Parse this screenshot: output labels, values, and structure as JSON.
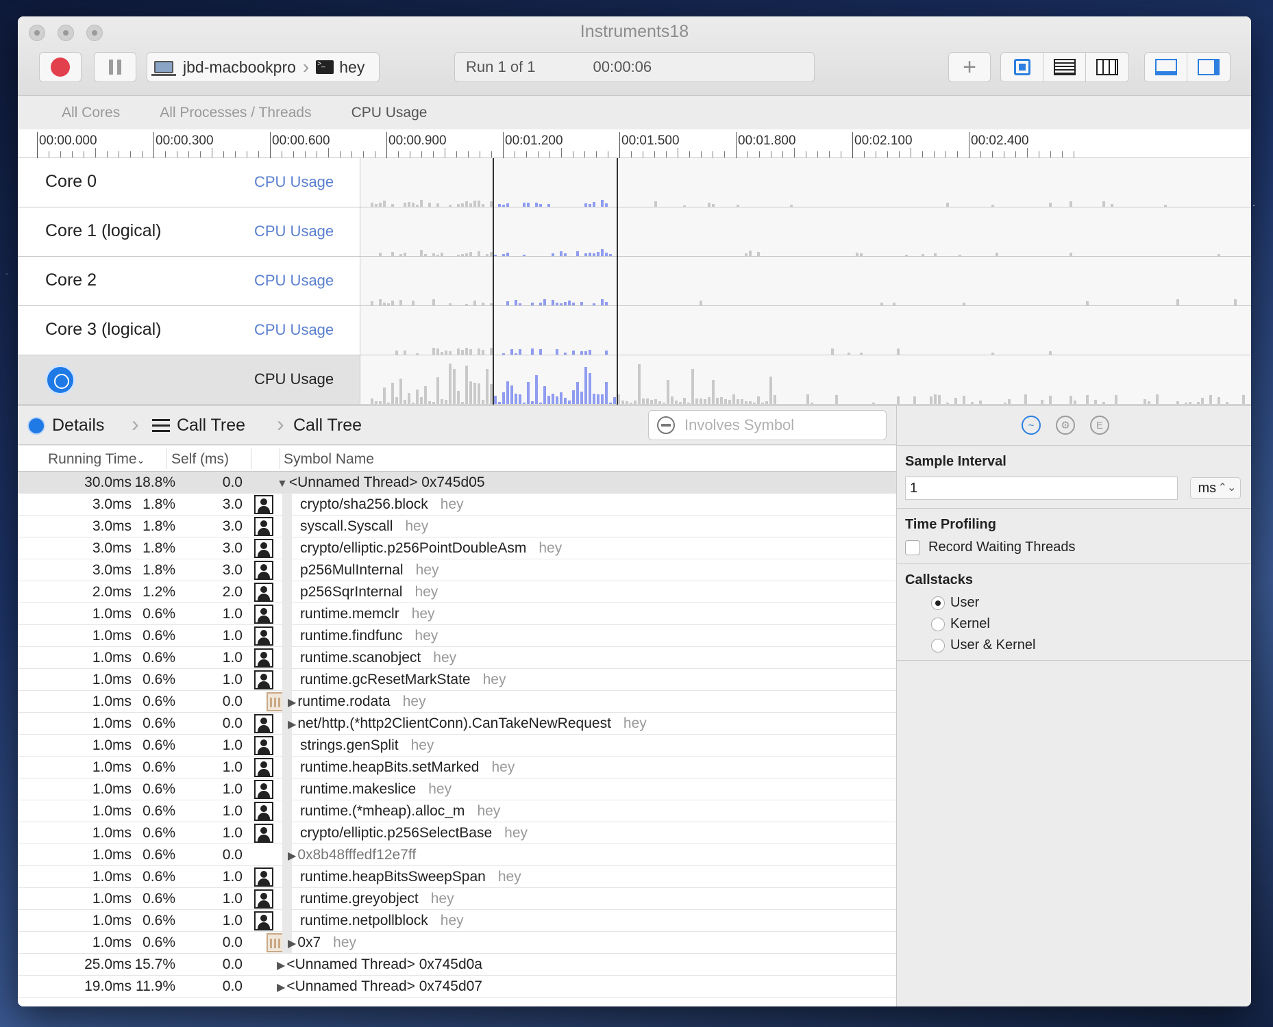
{
  "window": {
    "title": "Instruments18"
  },
  "toolbar": {
    "device": "jbd-macbookpro",
    "process": "hey",
    "run_label": "Run 1 of 1",
    "run_time": "00:00:06"
  },
  "scope": {
    "tabs": [
      "All Cores",
      "All Processes / Threads",
      "CPU Usage"
    ],
    "active": "CPU Usage"
  },
  "ruler": {
    "labels": [
      "00:00.000",
      "00:00.300",
      "00:00.600",
      "00:00.900",
      "00:01.200",
      "00:01.500",
      "00:01.800",
      "00:02.100",
      "00:02.400"
    ]
  },
  "tracks": [
    {
      "name": "Core 0",
      "instrument": "CPU Usage"
    },
    {
      "name": "Core 1 (logical)",
      "instrument": "CPU Usage"
    },
    {
      "name": "Core 2",
      "instrument": "CPU Usage"
    },
    {
      "name": "Core 3 (logical)",
      "instrument": "CPU Usage"
    },
    {
      "name": "",
      "instrument": "CPU Usage"
    }
  ],
  "detail_nav": {
    "details": "Details",
    "call_tree_1": "Call Tree",
    "call_tree_2": "Call Tree",
    "search_placeholder": "Involves Symbol"
  },
  "table": {
    "headers": {
      "running_time": "Running Time",
      "self": "Self (ms)",
      "symbol": "Symbol Name"
    },
    "rows": [
      {
        "rt": "30.0ms",
        "pct": "18.8%",
        "self": "0.0",
        "icon": "",
        "tri": "▼",
        "indent": 0,
        "sym": "<Unnamed Thread> 0x745d05",
        "lib": "",
        "hi": true
      },
      {
        "rt": "3.0ms",
        "pct": "1.8%",
        "self": "3.0",
        "icon": "user",
        "tri": "",
        "indent": 1,
        "sym": "crypto/sha256.block",
        "lib": "hey"
      },
      {
        "rt": "3.0ms",
        "pct": "1.8%",
        "self": "3.0",
        "icon": "user",
        "tri": "",
        "indent": 1,
        "sym": "syscall.Syscall",
        "lib": "hey"
      },
      {
        "rt": "3.0ms",
        "pct": "1.8%",
        "self": "3.0",
        "icon": "user",
        "tri": "",
        "indent": 1,
        "sym": "crypto/elliptic.p256PointDoubleAsm",
        "lib": "hey"
      },
      {
        "rt": "3.0ms",
        "pct": "1.8%",
        "self": "3.0",
        "icon": "user",
        "tri": "",
        "indent": 1,
        "sym": "p256MulInternal",
        "lib": "hey"
      },
      {
        "rt": "2.0ms",
        "pct": "1.2%",
        "self": "2.0",
        "icon": "user",
        "tri": "",
        "indent": 1,
        "sym": "p256SqrInternal",
        "lib": "hey"
      },
      {
        "rt": "1.0ms",
        "pct": "0.6%",
        "self": "1.0",
        "icon": "user",
        "tri": "",
        "indent": 1,
        "sym": "runtime.memclr",
        "lib": "hey"
      },
      {
        "rt": "1.0ms",
        "pct": "0.6%",
        "self": "1.0",
        "icon": "user",
        "tri": "",
        "indent": 1,
        "sym": "runtime.findfunc",
        "lib": "hey"
      },
      {
        "rt": "1.0ms",
        "pct": "0.6%",
        "self": "1.0",
        "icon": "user",
        "tri": "",
        "indent": 1,
        "sym": "runtime.scanobject",
        "lib": "hey"
      },
      {
        "rt": "1.0ms",
        "pct": "0.6%",
        "self": "1.0",
        "icon": "user",
        "tri": "",
        "indent": 1,
        "sym": "runtime.gcResetMarkState",
        "lib": "hey"
      },
      {
        "rt": "1.0ms",
        "pct": "0.6%",
        "self": "0.0",
        "icon": "lib",
        "tri": "▶",
        "indent": 1,
        "sym": "runtime.rodata",
        "lib": "hey"
      },
      {
        "rt": "1.0ms",
        "pct": "0.6%",
        "self": "0.0",
        "icon": "user",
        "tri": "▶",
        "indent": 1,
        "sym": "net/http.(*http2ClientConn).CanTakeNewRequest",
        "lib": "hey"
      },
      {
        "rt": "1.0ms",
        "pct": "0.6%",
        "self": "1.0",
        "icon": "user",
        "tri": "",
        "indent": 1,
        "sym": "strings.genSplit",
        "lib": "hey"
      },
      {
        "rt": "1.0ms",
        "pct": "0.6%",
        "self": "1.0",
        "icon": "user",
        "tri": "",
        "indent": 1,
        "sym": "runtime.heapBits.setMarked",
        "lib": "hey"
      },
      {
        "rt": "1.0ms",
        "pct": "0.6%",
        "self": "1.0",
        "icon": "user",
        "tri": "",
        "indent": 1,
        "sym": "runtime.makeslice",
        "lib": "hey"
      },
      {
        "rt": "1.0ms",
        "pct": "0.6%",
        "self": "1.0",
        "icon": "user",
        "tri": "",
        "indent": 1,
        "sym": "runtime.(*mheap).alloc_m",
        "lib": "hey"
      },
      {
        "rt": "1.0ms",
        "pct": "0.6%",
        "self": "1.0",
        "icon": "user",
        "tri": "",
        "indent": 1,
        "sym": "crypto/elliptic.p256SelectBase",
        "lib": "hey"
      },
      {
        "rt": "1.0ms",
        "pct": "0.6%",
        "self": "0.0",
        "icon": "",
        "tri": "▶",
        "indent": 1,
        "sym": "0x8b48fffedf12e7ff",
        "lib": "",
        "gray": true
      },
      {
        "rt": "1.0ms",
        "pct": "0.6%",
        "self": "1.0",
        "icon": "user",
        "tri": "",
        "indent": 1,
        "sym": "runtime.heapBitsSweepSpan",
        "lib": "hey"
      },
      {
        "rt": "1.0ms",
        "pct": "0.6%",
        "self": "1.0",
        "icon": "user",
        "tri": "",
        "indent": 1,
        "sym": "runtime.greyobject",
        "lib": "hey"
      },
      {
        "rt": "1.0ms",
        "pct": "0.6%",
        "self": "1.0",
        "icon": "user",
        "tri": "",
        "indent": 1,
        "sym": "runtime.netpollblock",
        "lib": "hey"
      },
      {
        "rt": "1.0ms",
        "pct": "0.6%",
        "self": "0.0",
        "icon": "lib",
        "tri": "▶",
        "indent": 1,
        "sym": "0x7",
        "lib": "hey"
      },
      {
        "rt": "25.0ms",
        "pct": "15.7%",
        "self": "0.0",
        "icon": "",
        "tri": "▶",
        "indent": 0,
        "sym": "<Unnamed Thread> 0x745d0a",
        "lib": ""
      },
      {
        "rt": "19.0ms",
        "pct": "11.9%",
        "self": "0.0",
        "icon": "",
        "tri": "▶",
        "indent": 0,
        "sym": "<Unnamed Thread> 0x745d07",
        "lib": ""
      }
    ]
  },
  "inspector": {
    "sample_interval_label": "Sample Interval",
    "sample_interval_value": "1",
    "unit": "ms",
    "time_profiling_label": "Time Profiling",
    "record_waiting": "Record Waiting Threads",
    "callstacks_label": "Callstacks",
    "radios": [
      "User",
      "Kernel",
      "User & Kernel"
    ],
    "selected_radio": "User"
  },
  "colors": {
    "accent": "#2d7fe0",
    "record": "#e2404d",
    "selection_bars": "#8f9cf0",
    "graph_bars": "#c9c9c9"
  }
}
